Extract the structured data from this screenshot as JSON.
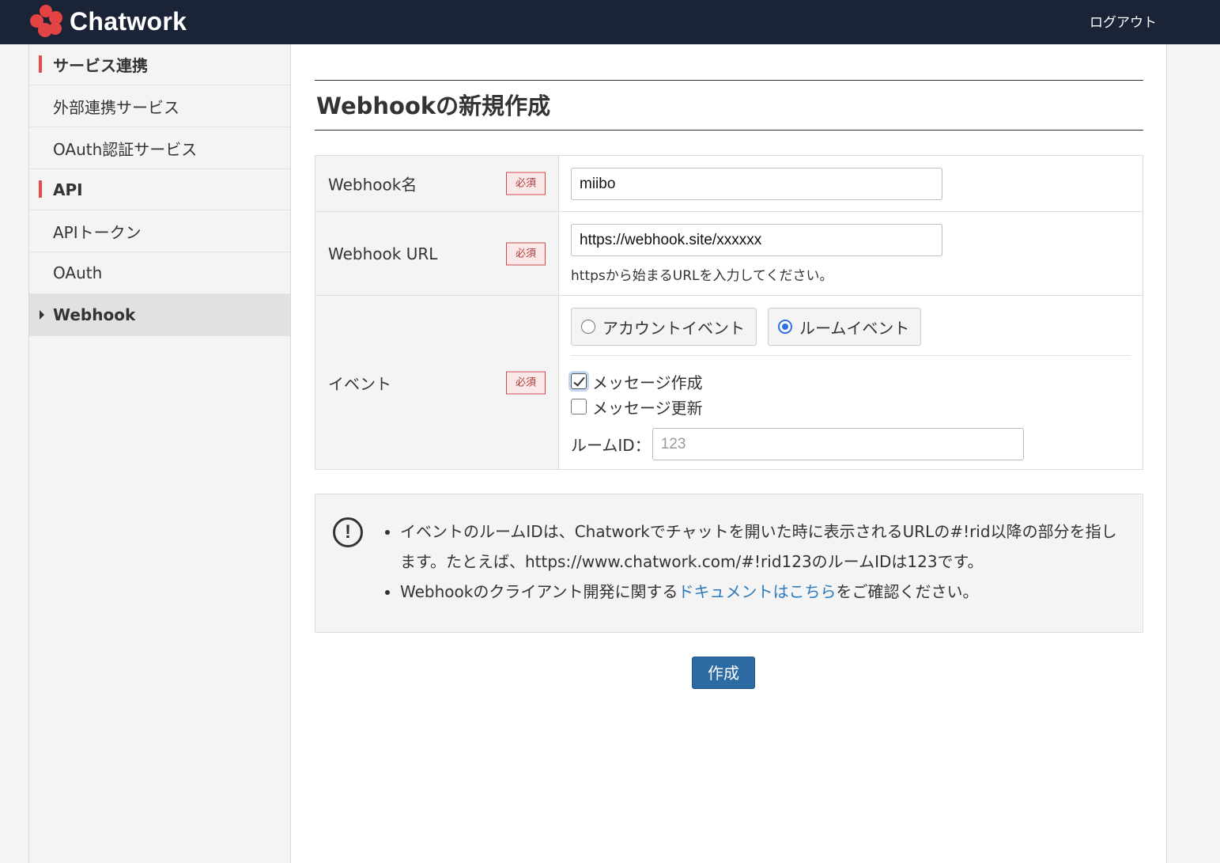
{
  "header": {
    "brand": "Chatwork",
    "logout_label": "ログアウト",
    "brand_color": "#e44344",
    "bar_color": "#1b2336"
  },
  "sidebar": {
    "sections": [
      {
        "title": "サービス連携",
        "items": [
          {
            "label": "外部連携サービス",
            "active": false
          },
          {
            "label": "OAuth認証サービス",
            "active": false
          }
        ]
      },
      {
        "title": "API",
        "items": [
          {
            "label": "APIトークン",
            "active": false
          },
          {
            "label": "OAuth",
            "active": false
          },
          {
            "label": "Webhook",
            "active": true
          }
        ]
      }
    ]
  },
  "page": {
    "title": "Webhookの新規作成"
  },
  "form": {
    "required_label": "必須",
    "name": {
      "label": "Webhook名",
      "value": "miibo"
    },
    "url": {
      "label": "Webhook URL",
      "value": "https://webhook.site/xxxxxx",
      "hint": "httpsから始まるURLを入力してください。"
    },
    "event": {
      "label": "イベント",
      "radio_account": "アカウントイベント",
      "radio_room": "ルームイベント",
      "selected": "room",
      "check_create": "メッセージ作成",
      "check_create_checked": true,
      "check_update": "メッセージ更新",
      "check_update_checked": false,
      "room_id_label": "ルームID：",
      "room_id_placeholder": "123"
    }
  },
  "notice": {
    "line1": "イベントのルームIDは、Chatworkでチャットを開いた時に表示されるURLの#!rid以降の部分を指します。たとえば、https://www.chatwork.com/#!rid123のルームIDは123です。",
    "line2_before": "Webhookのクライアント開発に関する",
    "line2_link": "ドキュメントはこちら",
    "line2_after": "をご確認ください。"
  },
  "actions": {
    "create_label": "作成",
    "create_color": "#2b6aa3"
  }
}
